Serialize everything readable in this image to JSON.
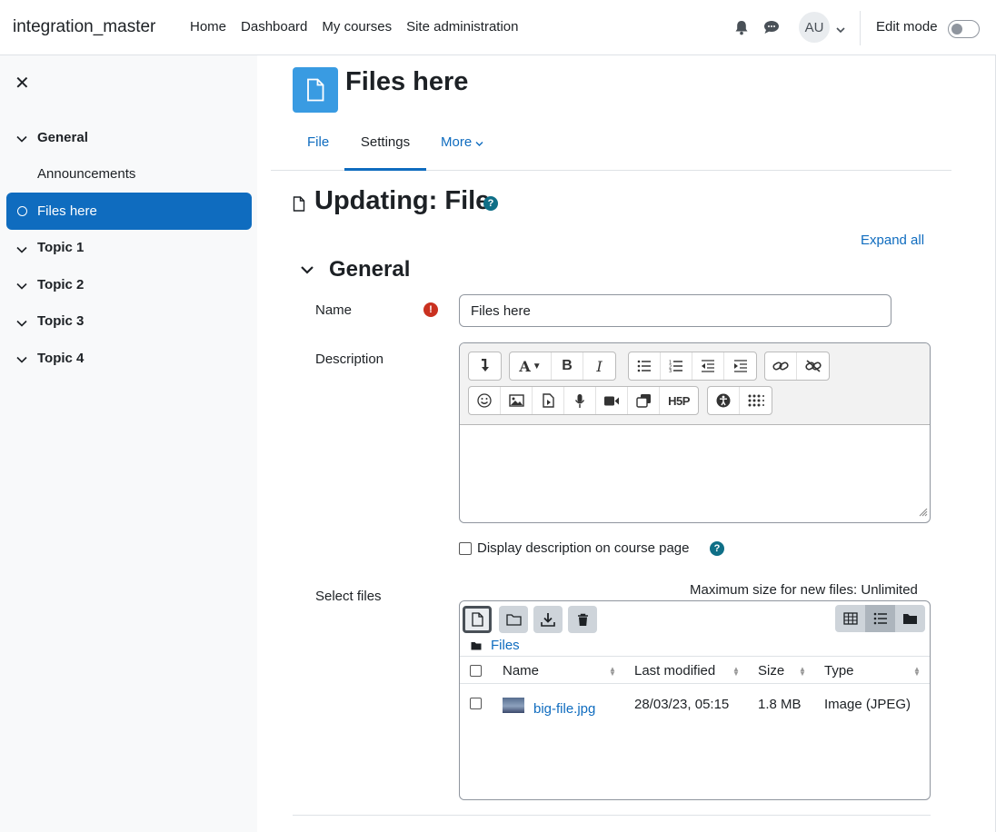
{
  "navbar": {
    "brand": "integration_master",
    "links": [
      "Home",
      "Dashboard",
      "My courses",
      "Site administration"
    ],
    "avatar_initials": "AU",
    "edit_mode_label": "Edit mode",
    "edit_mode_on": false
  },
  "course_index": {
    "items": [
      {
        "type": "section",
        "label": "General"
      },
      {
        "type": "activity",
        "label": "Announcements"
      },
      {
        "type": "activity",
        "label": "Files here",
        "active": true
      },
      {
        "type": "section",
        "label": "Topic 1"
      },
      {
        "type": "section",
        "label": "Topic 2"
      },
      {
        "type": "section",
        "label": "Topic 3"
      },
      {
        "type": "section",
        "label": "Topic 4"
      }
    ]
  },
  "activity": {
    "title": "Files here",
    "icon": "file-icon",
    "accent": "#399be2"
  },
  "tabs": {
    "file": "File",
    "settings": "Settings",
    "more": "More"
  },
  "form": {
    "heading": "Updating: File",
    "expand_all": "Expand all",
    "section_general": "General",
    "name_label": "Name",
    "name_value": "Files here",
    "description_label": "Description",
    "description_value": "",
    "display_desc_label": "Display description on course page",
    "display_desc_checked": false,
    "select_files_label": "Select files",
    "max_size": "Maximum size for new files: Unlimited"
  },
  "filemanager": {
    "path_root": "Files",
    "columns": [
      "Name",
      "Last modified",
      "Size",
      "Type"
    ],
    "files": [
      {
        "name": "big-file.jpg",
        "modified": "28/03/23, 05:15",
        "size": "1.8 MB",
        "type": "Image (JPEG)"
      }
    ]
  },
  "colors": {
    "primary": "#0f6cbf",
    "required": "#ca3120",
    "help": "#0f6f87"
  }
}
